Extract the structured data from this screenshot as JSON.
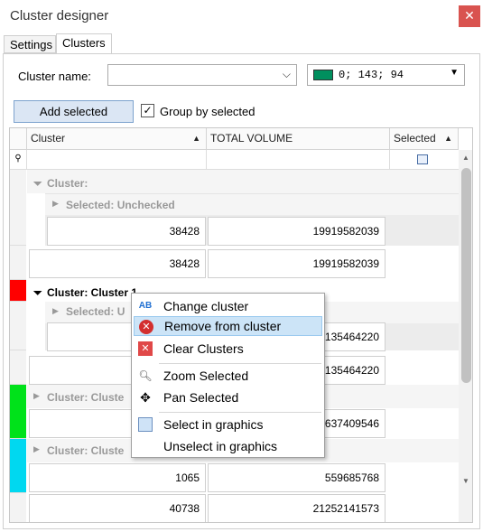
{
  "window": {
    "title": "Cluster designer",
    "close_glyph": "✕"
  },
  "tabs": [
    {
      "label": "Settings"
    },
    {
      "label": "Clusters"
    }
  ],
  "form": {
    "cluster_name_label": "Cluster name:",
    "cluster_name_value": "",
    "color_value": "0; 143; 94",
    "color_swatch": "#008f5e",
    "add_selected_label": "Add selected",
    "group_by_selected_label": "Group by selected",
    "group_by_selected_checked": true
  },
  "grid": {
    "headers": {
      "cluster": "Cluster",
      "total_volume": "TOTAL VOLUME",
      "selected": "Selected"
    },
    "groups": {
      "g1": "Cluster:",
      "g1_sub": "Selected: Unchecked",
      "g2": "Cluster: Cluster 1",
      "g2_sub": "Selected: U",
      "g3": "Cluster: Cluste",
      "g4": "Cluster: Cluste"
    },
    "rows": [
      {
        "a": "38428",
        "b": "19919582039"
      },
      {
        "a": "38428",
        "b": "19919582039"
      },
      {
        "a": "",
        "b": "135464220"
      },
      {
        "a": "",
        "b": "135464220"
      },
      {
        "a": "",
        "b": "637409546"
      },
      {
        "a": "1065",
        "b": "559685768"
      },
      {
        "a": "40738",
        "b": "21252141573"
      }
    ],
    "group_colors": {
      "g2": "#ff0000",
      "g3": "#00e21a",
      "g4": "#00d8f0"
    }
  },
  "context_menu": {
    "items": [
      {
        "label": "Change cluster",
        "icon": "change-cluster-icon"
      },
      {
        "label": "Remove from cluster",
        "icon": "remove-icon"
      },
      {
        "label": "Clear Clusters",
        "icon": "clear-icon"
      },
      {
        "label": "Zoom Selected",
        "icon": "zoom-icon"
      },
      {
        "label": "Pan Selected",
        "icon": "pan-icon"
      },
      {
        "label": "Select in graphics",
        "icon": "select-graphics-icon"
      },
      {
        "label": "Unselect in graphics",
        "icon": "unselect-graphics-icon"
      }
    ]
  }
}
